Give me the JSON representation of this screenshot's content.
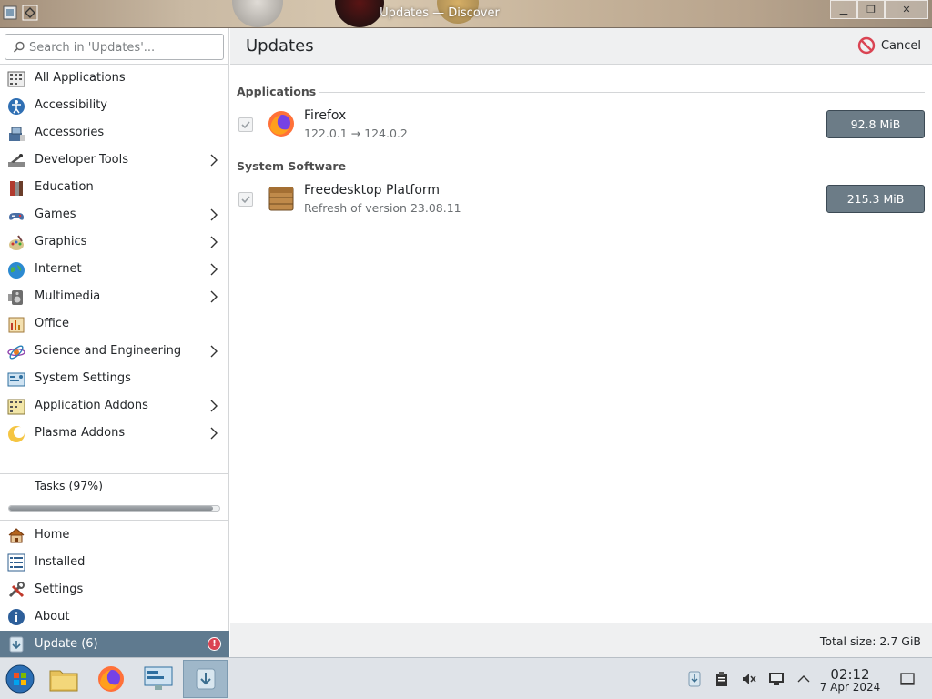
{
  "window": {
    "title": "Updates — Discover",
    "min_label": "▁",
    "max_label": "❐",
    "close_label": "✕"
  },
  "search": {
    "placeholder": "Search in 'Updates'..."
  },
  "categories": [
    {
      "label": "All Applications",
      "icon": "grid-icon",
      "submenu": false
    },
    {
      "label": "Accessibility",
      "icon": "accessibility-icon",
      "submenu": false
    },
    {
      "label": "Accessories",
      "icon": "accessories-icon",
      "submenu": false
    },
    {
      "label": "Developer Tools",
      "icon": "developer-tools-icon",
      "submenu": true
    },
    {
      "label": "Education",
      "icon": "education-icon",
      "submenu": false
    },
    {
      "label": "Games",
      "icon": "games-icon",
      "submenu": true
    },
    {
      "label": "Graphics",
      "icon": "graphics-icon",
      "submenu": true
    },
    {
      "label": "Internet",
      "icon": "internet-icon",
      "submenu": true
    },
    {
      "label": "Multimedia",
      "icon": "multimedia-icon",
      "submenu": true
    },
    {
      "label": "Office",
      "icon": "office-icon",
      "submenu": false
    },
    {
      "label": "Science and Engineering",
      "icon": "science-icon",
      "submenu": true
    },
    {
      "label": "System Settings",
      "icon": "system-settings-icon",
      "submenu": false
    },
    {
      "label": "Application Addons",
      "icon": "addons-icon",
      "submenu": true
    },
    {
      "label": "Plasma Addons",
      "icon": "plasma-icon",
      "submenu": true
    }
  ],
  "tasks": {
    "label": "Tasks (97%)",
    "progress": 0.97
  },
  "nav": {
    "home": "Home",
    "installed": "Installed",
    "settings": "Settings",
    "about": "About",
    "update": "Update (6)",
    "update_badge": "!"
  },
  "header": {
    "title": "Updates",
    "cancel": "Cancel"
  },
  "sections": {
    "applications": "Applications",
    "system": "System Software"
  },
  "updates": [
    {
      "name": "Firefox",
      "detail": "122.0.1 → 124.0.2",
      "size": "92.8 MiB",
      "checked": true,
      "icon": "firefox-icon"
    },
    {
      "name": "Freedesktop Platform",
      "detail": "Refresh of version 23.08.11",
      "size": "215.3 MiB",
      "checked": true,
      "icon": "package-icon"
    }
  ],
  "footer": {
    "total": "Total size: 2.7 GiB"
  },
  "clock": {
    "time": "02:12",
    "date": "7 Apr 2024"
  },
  "colors": {
    "accent": "#5f7a8f",
    "size_button": "#6c7c87",
    "badge": "#da4453",
    "cancel": "#da4453"
  }
}
